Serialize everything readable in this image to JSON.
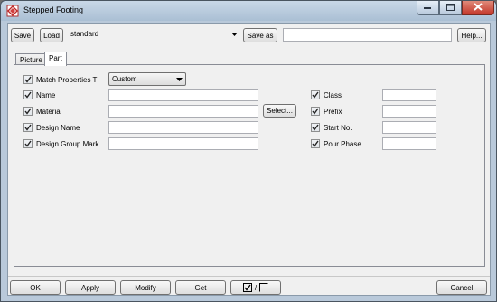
{
  "window": {
    "title": "Stepped Footing"
  },
  "toolbar": {
    "save_label": "Save",
    "load_label": "Load",
    "load_value": "standard",
    "save_as_label": "Save as",
    "save_as_value": "",
    "help_label": "Help..."
  },
  "tabs": [
    {
      "label": "Picture",
      "active": false
    },
    {
      "label": "Part",
      "active": true
    }
  ],
  "part": {
    "match": {
      "label": "Match  Properties T",
      "checked": true,
      "value": "Custom"
    },
    "name": {
      "label": "Name",
      "checked": true,
      "value": ""
    },
    "material": {
      "label": "Material",
      "checked": true,
      "value": "",
      "select_label": "Select..."
    },
    "design_name": {
      "label": "Design Name",
      "checked": true,
      "value": ""
    },
    "design_group_mark": {
      "label": "Design Group Mark",
      "checked": true,
      "value": ""
    },
    "class": {
      "label": "Class",
      "checked": true,
      "value": ""
    },
    "prefix": {
      "label": "Prefix",
      "checked": true,
      "value": ""
    },
    "start_no": {
      "label": "Start No.",
      "checked": true,
      "value": ""
    },
    "pour_phase": {
      "label": "Pour Phase",
      "checked": true,
      "value": ""
    }
  },
  "footer": {
    "ok_label": "OK",
    "apply_label": "Apply",
    "modify_label": "Modify",
    "get_label": "Get",
    "toggle_separator": "/",
    "cancel_label": "Cancel"
  }
}
